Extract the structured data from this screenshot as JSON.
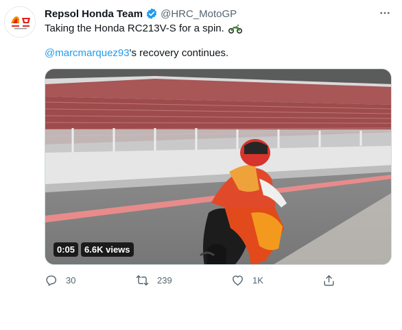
{
  "tweet": {
    "display_name": "Repsol Honda Team",
    "handle": "@HRC_MotoGP",
    "text_line1": "Taking the Honda RC213V-S for a spin.",
    "mention": "@marcmarquez93",
    "text_line2_rest": "'s recovery continues.",
    "emoji_icon": "motorcycle-emoji-icon",
    "avatar_icon": "repsol-honda-logo",
    "verified_icon": "verified-badge-icon",
    "accent_color": "#1d9bf0"
  },
  "media": {
    "duration": "0:05",
    "views": "6.6K views"
  },
  "actions": {
    "reply_count": "30",
    "retweet_count": "239",
    "like_count": "1K"
  }
}
